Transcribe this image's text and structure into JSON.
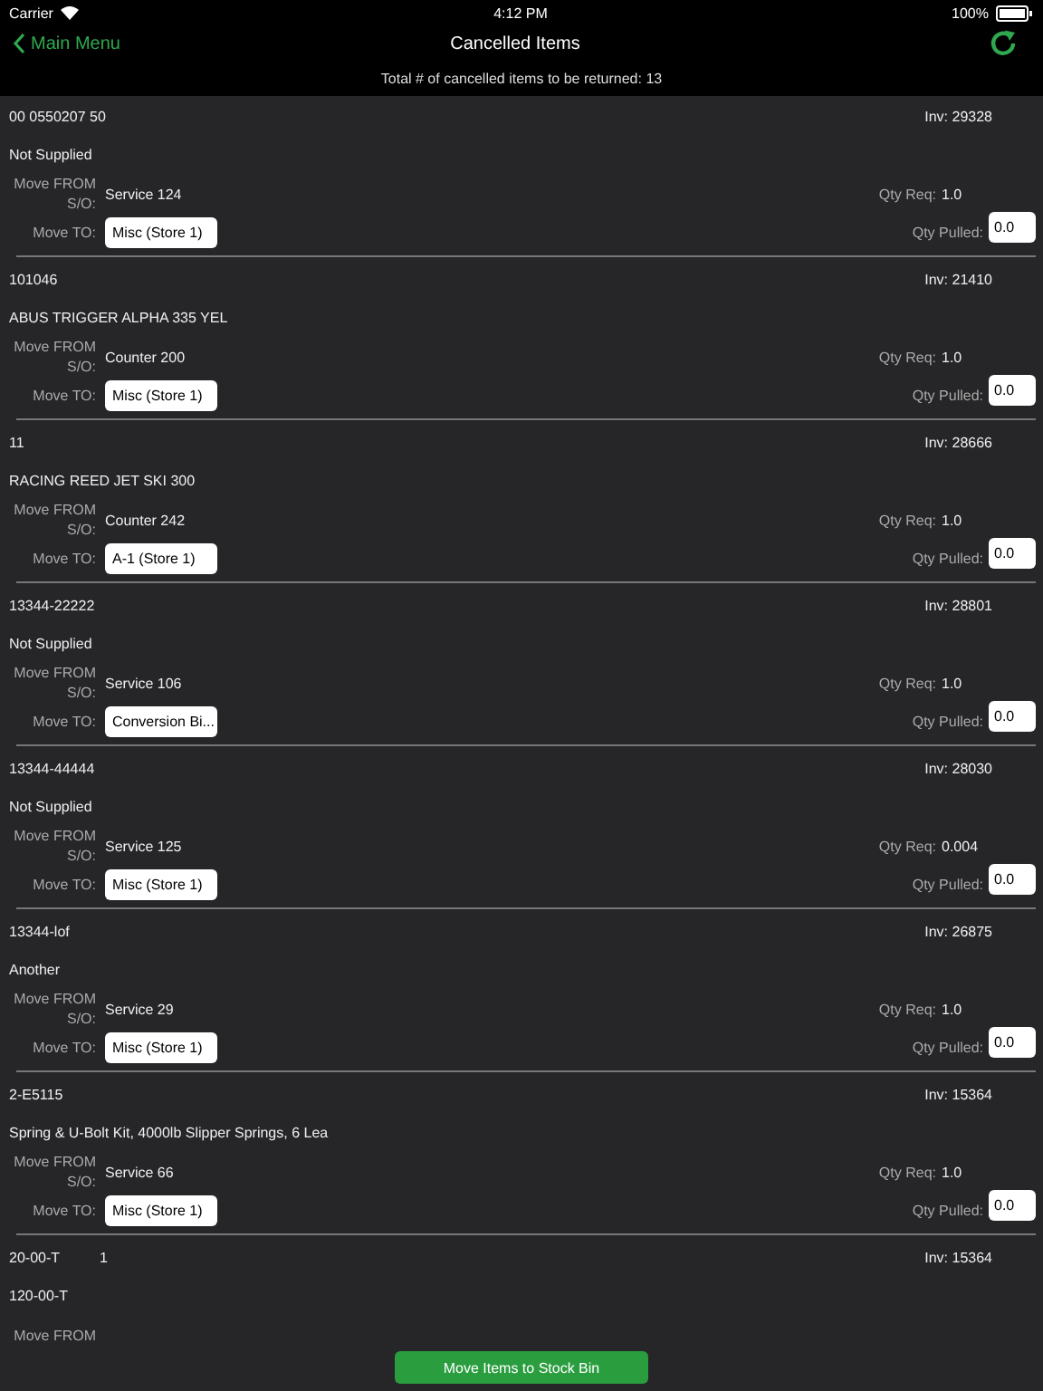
{
  "status_bar": {
    "carrier": "Carrier",
    "time": "4:12 PM",
    "battery": "100%"
  },
  "nav": {
    "back": "Main Menu",
    "title": "Cancelled Items"
  },
  "summary": "Total # of cancelled items to be returned: 13",
  "items": [
    {
      "part": "00 0550207 50",
      "inv": "Inv: 29328",
      "description": "Not Supplied",
      "from_label": "Move FROM S/O:",
      "from": "Service 124",
      "to_label": "Move TO:",
      "to": "Misc (Store 1)",
      "qty_req_label": "Qty Req:",
      "qty_req": "1.0",
      "qty_pulled_label": "Qty Pulled:",
      "qty_pulled": "0.0"
    },
    {
      "part": "101046",
      "inv": "Inv: 21410",
      "description": "ABUS TRIGGER ALPHA 335 YEL",
      "from_label": "Move FROM S/O:",
      "from": "Counter 200",
      "to_label": "Move TO:",
      "to": "Misc (Store 1)",
      "qty_req_label": "Qty Req:",
      "qty_req": "1.0",
      "qty_pulled_label": "Qty Pulled:",
      "qty_pulled": "0.0"
    },
    {
      "part": "11",
      "inv": "Inv: 28666",
      "description": "RACING REED JET SKI 300",
      "from_label": "Move FROM S/O:",
      "from": "Counter 242",
      "to_label": "Move TO:",
      "to": "A-1 (Store 1)",
      "qty_req_label": "Qty Req:",
      "qty_req": "1.0",
      "qty_pulled_label": "Qty Pulled:",
      "qty_pulled": "0.0"
    },
    {
      "part": "13344-22222",
      "inv": "Inv: 28801",
      "description": "Not Supplied",
      "from_label": "Move FROM S/O:",
      "from": "Service 106",
      "to_label": "Move TO:",
      "to": "Conversion Bi...",
      "qty_req_label": "Qty Req:",
      "qty_req": "1.0",
      "qty_pulled_label": "Qty Pulled:",
      "qty_pulled": "0.0"
    },
    {
      "part": "13344-44444",
      "inv": "Inv: 28030",
      "description": "Not Supplied",
      "from_label": "Move FROM S/O:",
      "from": "Service 125",
      "to_label": "Move TO:",
      "to": "Misc (Store 1)",
      "qty_req_label": "Qty Req:",
      "qty_req": "0.004",
      "qty_pulled_label": "Qty Pulled:",
      "qty_pulled": "0.0"
    },
    {
      "part": "13344-lof",
      "inv": "Inv: 26875",
      "description": "Another",
      "from_label": "Move FROM S/O:",
      "from": "Service 29",
      "to_label": "Move TO:",
      "to": "Misc (Store 1)",
      "qty_req_label": "Qty Req:",
      "qty_req": "1.0",
      "qty_pulled_label": "Qty Pulled:",
      "qty_pulled": "0.0"
    },
    {
      "part": "2-E5115",
      "inv": "Inv: 15364",
      "description": "Spring & U-Bolt Kit, 4000lb Slipper Springs, 6 Lea",
      "from_label": "Move FROM S/O:",
      "from": "Service 66",
      "to_label": "Move TO:",
      "to": "Misc (Store 1)",
      "qty_req_label": "Qty Req:",
      "qty_req": "1.0",
      "qty_pulled_label": "Qty Pulled:",
      "qty_pulled": "0.0"
    },
    {
      "part": "20-00-T",
      "extra": "1",
      "inv": "Inv: 15364",
      "description": "120-00-T",
      "from_label": "Move FROM"
    }
  ],
  "action_button": "Move Items to Stock Bin"
}
